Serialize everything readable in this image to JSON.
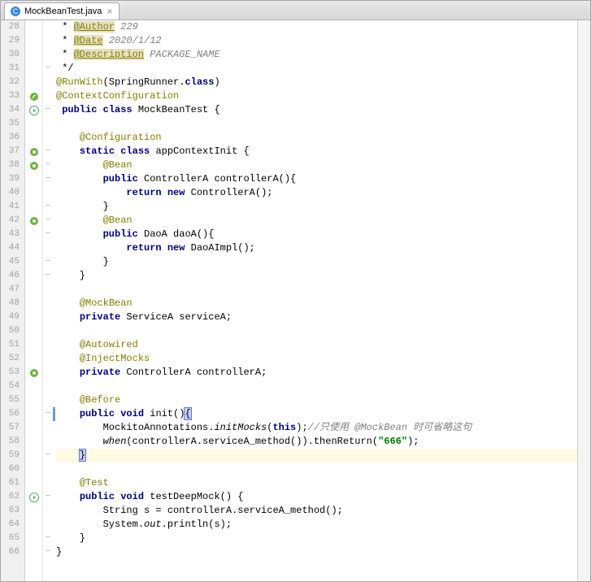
{
  "tab": {
    "filename": "MockBeanTest.java"
  },
  "gutter": {
    "start": 28,
    "end": 66
  },
  "lines": [
    {
      "n": 28,
      "html": " * <span class='ann-hl'>@Author</span><span class='com'> 229</span>"
    },
    {
      "n": 29,
      "html": " * <span class='ann-hl'>@Date</span><span class='com'> 2020/1/12</span>"
    },
    {
      "n": 30,
      "html": " * <span class='ann-hl'>@Description</span><span class='com'> PACKAGE_NAME</span>"
    },
    {
      "n": 31,
      "html": " */",
      "fold": "⊟"
    },
    {
      "n": 32,
      "html": "<span class='ann'>@RunWith</span>(SpringRunner.<span class='kw'>class</span>)"
    },
    {
      "n": 33,
      "html": "<span class='ann'>@ContextConfiguration</span>",
      "icon": "spring"
    },
    {
      "n": 34,
      "html": " <span class='kw'>public</span> <span class='kw'>class</span> MockBeanTest {",
      "icon": "run",
      "fold": "⊟"
    },
    {
      "n": 35,
      "html": ""
    },
    {
      "n": 36,
      "html": "    <span class='ann'>@Configuration</span>"
    },
    {
      "n": 37,
      "html": "    <span class='kw'>static</span> <span class='kw'>class</span> appContextInit {",
      "icon": "bean",
      "fold": "⊟"
    },
    {
      "n": 38,
      "html": "        <span class='ann'>@Bean</span>",
      "icon": "bean",
      "fold": "⊟"
    },
    {
      "n": 39,
      "html": "        <span class='kw'>public</span> ControllerA controllerA(){",
      "fold": "⊟"
    },
    {
      "n": 40,
      "html": "            <span class='kw'>return</span> <span class='kw'>new</span> ControllerA();"
    },
    {
      "n": 41,
      "html": "        }",
      "fold": "⊟"
    },
    {
      "n": 42,
      "html": "        <span class='ann'>@Bean</span>",
      "icon": "bean",
      "fold": "⊟"
    },
    {
      "n": 43,
      "html": "        <span class='kw'>public</span> DaoA daoA(){",
      "fold": "⊟"
    },
    {
      "n": 44,
      "html": "            <span class='kw'>return</span> <span class='kw'>new</span> DaoAImpl();"
    },
    {
      "n": 45,
      "html": "        }",
      "fold": "⊟"
    },
    {
      "n": 46,
      "html": "    }",
      "fold": "⊟"
    },
    {
      "n": 47,
      "html": ""
    },
    {
      "n": 48,
      "html": "    <span class='ann'>@MockBean</span>"
    },
    {
      "n": 49,
      "html": "    <span class='kw'>private</span> ServiceA serviceA;"
    },
    {
      "n": 50,
      "html": ""
    },
    {
      "n": 51,
      "html": "    <span class='ann'>@Autowired</span>"
    },
    {
      "n": 52,
      "html": "    <span class='ann'>@InjectMocks</span>"
    },
    {
      "n": 53,
      "html": "    <span class='kw'>private</span> ControllerA controllerA;",
      "icon": "bean"
    },
    {
      "n": 54,
      "html": ""
    },
    {
      "n": 55,
      "html": "    <span class='ann'>@Before</span>"
    },
    {
      "n": 56,
      "html": "    <span class='kw'>public</span> <span class='kw'>void</span> init()<span class='brace-hl'>{</span>",
      "fold": "⊟",
      "caret": true
    },
    {
      "n": 57,
      "html": "        MockitoAnnotations.<span class='itb'>initMocks</span>(<span class='kw'>this</span>);<span class='com'>//只使用 @MockBean 时可省略这句</span>"
    },
    {
      "n": 58,
      "html": "        <span class='itb'>when</span>(controllerA.serviceA_method()).thenReturn(<span class='str'>\"666\"</span>);"
    },
    {
      "n": 59,
      "html": "    <span class='brace-hl'>}</span>",
      "fold": "⊟",
      "hl": true
    },
    {
      "n": 60,
      "html": ""
    },
    {
      "n": 61,
      "html": "    <span class='ann'>@Test</span>"
    },
    {
      "n": 62,
      "html": "    <span class='kw'>public</span> <span class='kw'>void</span> testDeepMock() {",
      "icon": "run",
      "fold": "⊟"
    },
    {
      "n": 63,
      "html": "        String s = controllerA.serviceA_method();"
    },
    {
      "n": 64,
      "html": "        System.<span class='itb'>out</span>.println(s);"
    },
    {
      "n": 65,
      "html": "    }",
      "fold": "⊟"
    },
    {
      "n": 66,
      "html": "}",
      "fold": "⊟"
    }
  ]
}
